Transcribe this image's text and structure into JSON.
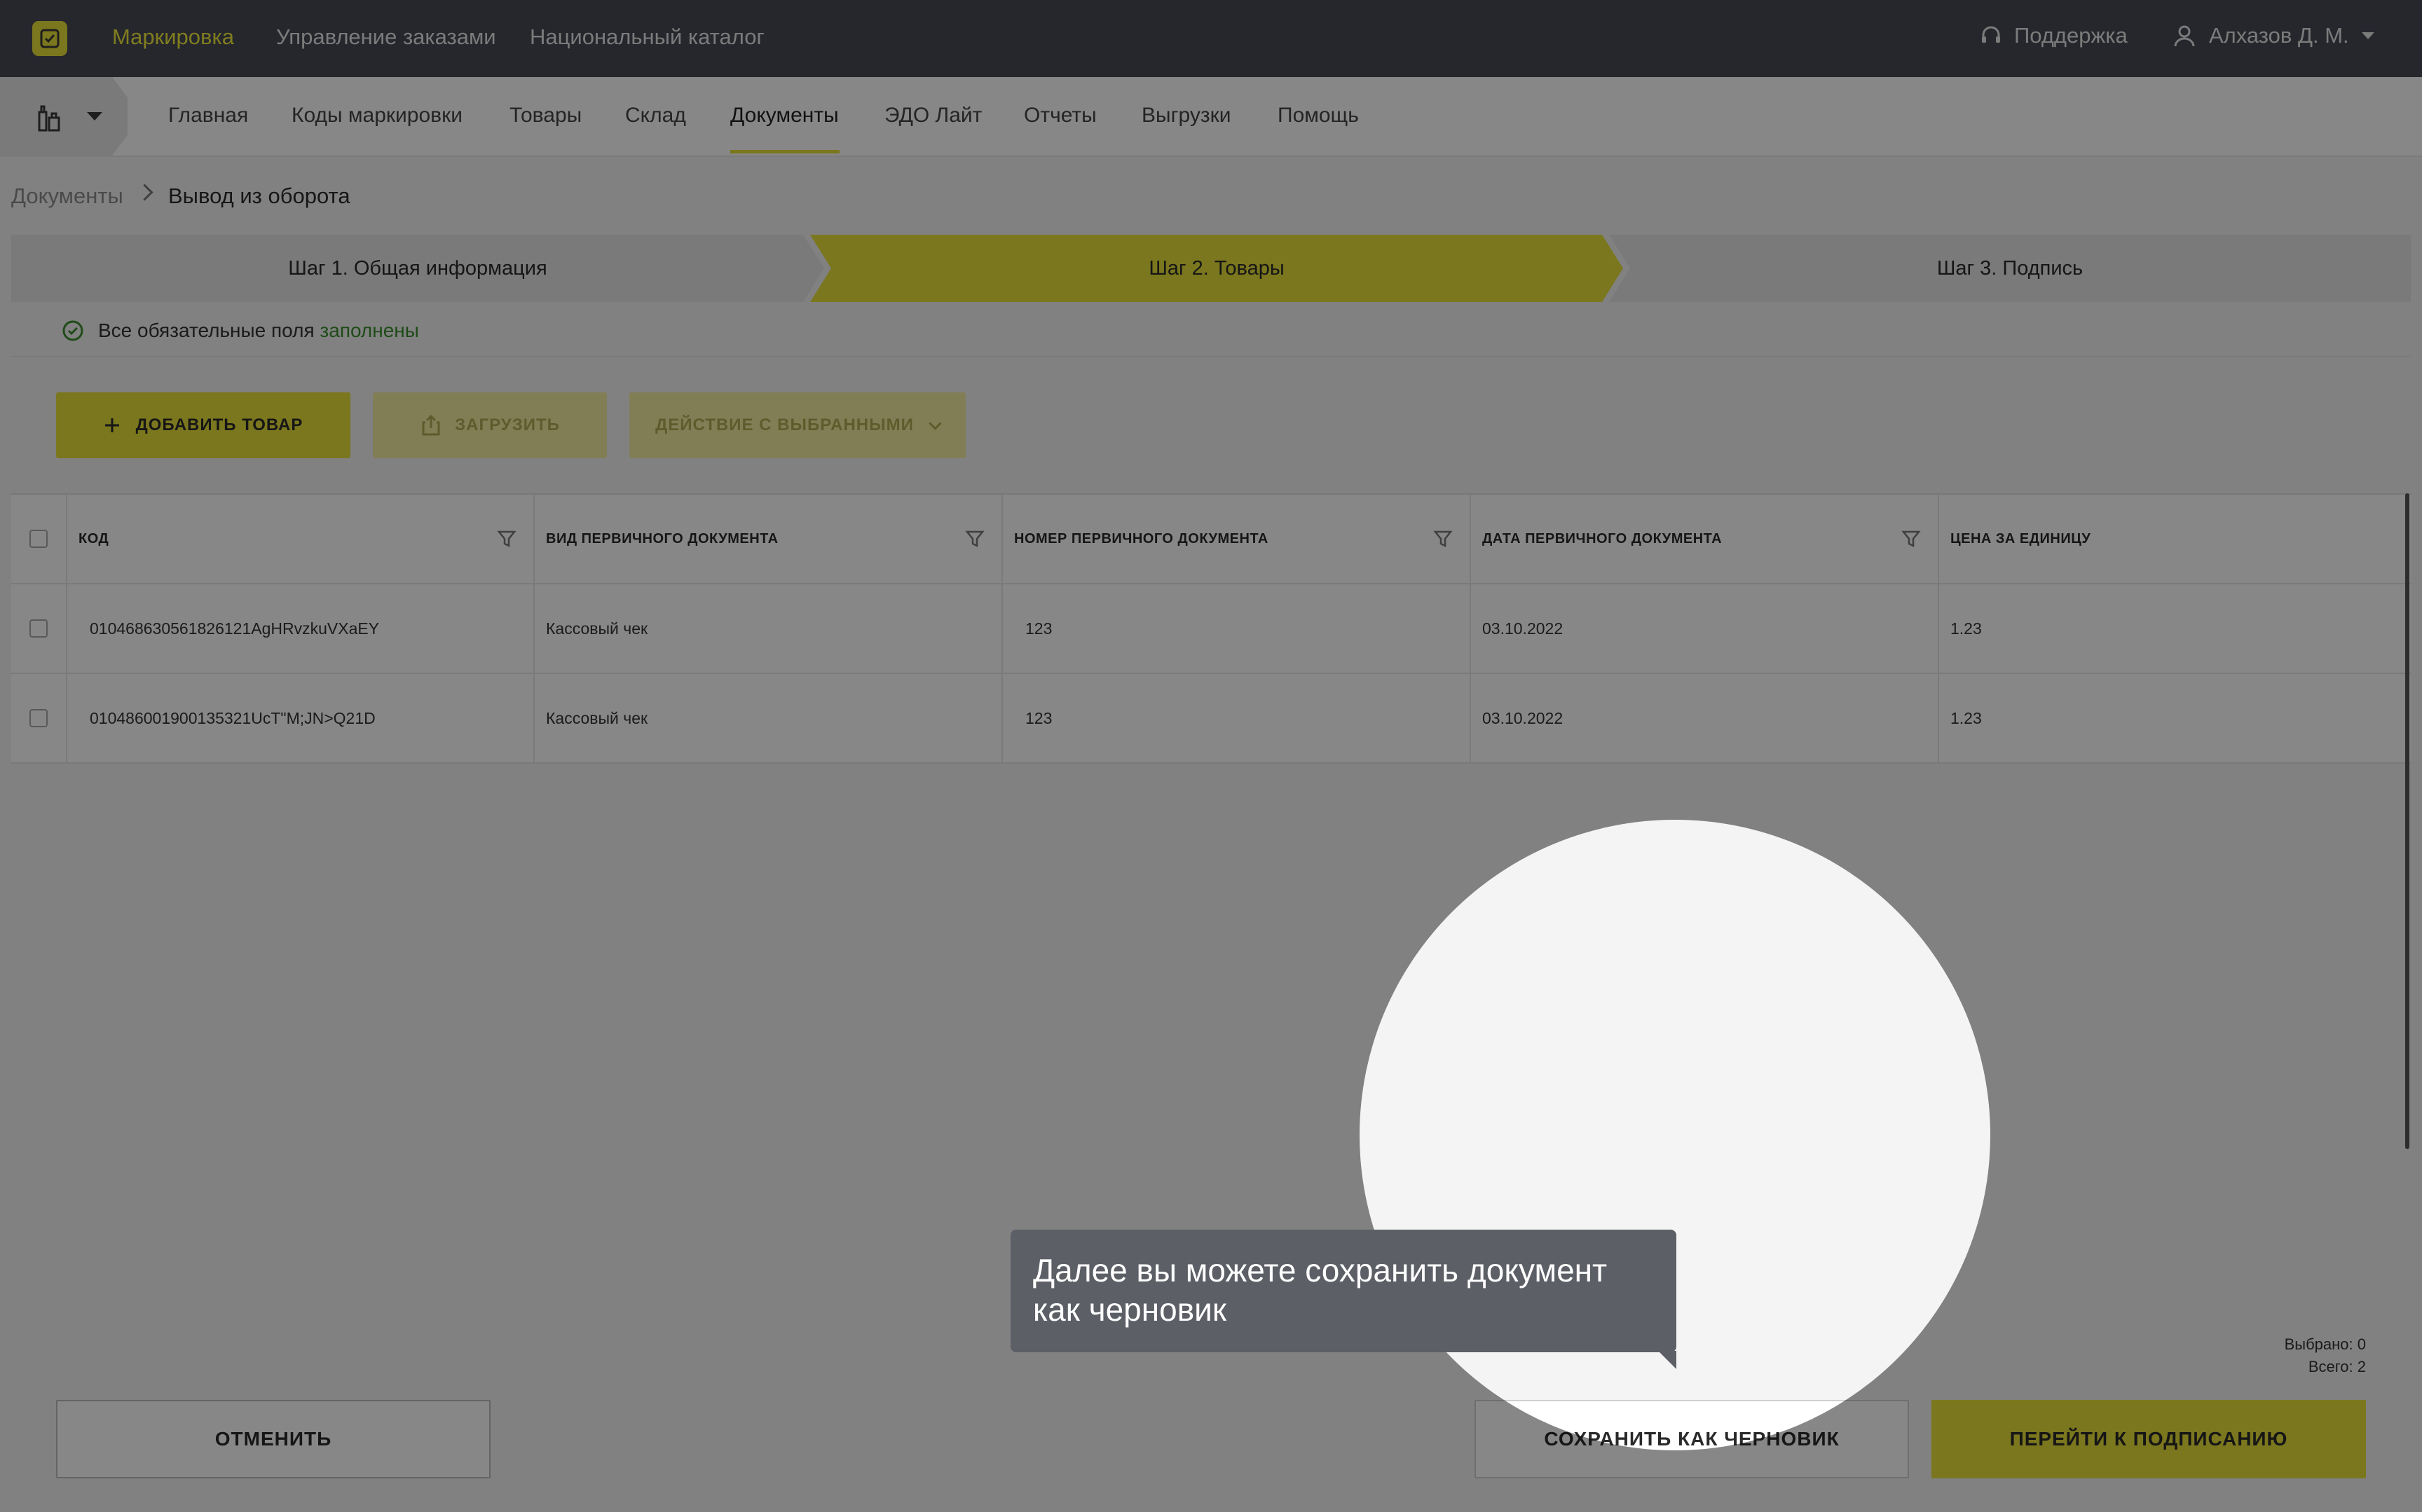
{
  "topnav": {
    "items": [
      "Маркировка",
      "Управление заказами",
      "Национальный каталог"
    ],
    "support": "Поддержка",
    "user": "Алхазов Д. М."
  },
  "subnav": {
    "items": [
      "Главная",
      "Коды маркировки",
      "Товары",
      "Склад",
      "Документы",
      "ЭДО Лайт",
      "Отчеты",
      "Выгрузки",
      "Помощь"
    ],
    "active": "Документы"
  },
  "breadcrumb": {
    "parent": "Документы",
    "current": "Вывод из оборота"
  },
  "steps": [
    "Шаг 1. Общая информация",
    "Шаг 2. Товары",
    "Шаг 3. Подпись"
  ],
  "active_step": 2,
  "status": {
    "text": "Все обязательные поля",
    "highlight": "заполнены"
  },
  "toolbar": {
    "add": "ДОБАВИТЬ ТОВАР",
    "upload": "ЗАГРУЗИТЬ",
    "action": "ДЕЙСТВИЕ С ВЫБРАННЫМИ"
  },
  "table": {
    "columns": [
      "КОД",
      "ВИД ПЕРВИЧНОГО ДОКУМЕНТА",
      "НОМЕР ПЕРВИЧНОГО ДОКУМЕНТА",
      "ДАТА ПЕРВИЧНОГО ДОКУМЕНТА",
      "ЦЕНА ЗА ЕДИНИЦУ"
    ],
    "rows": [
      [
        "010468630561826121AgHRvzkuVXaEY",
        "Кассовый чек",
        "123",
        "03.10.2022",
        "1.23"
      ],
      [
        "010486001900135321UcT\"M;JN>Q21D",
        "Кассовый чек",
        "123",
        "03.10.2022",
        "1.23"
      ]
    ]
  },
  "counts": {
    "selected": "Выбрано: 0",
    "total": "Всего: 2"
  },
  "footer": {
    "cancel": "ОТМЕНИТЬ",
    "draft": "СОХРАНИТЬ КАК ЧЕРНОВИК",
    "sign": "ПЕРЕЙТИ К ПОДПИСАНИЮ"
  },
  "tooltip": {
    "text": "Далее вы можете сохранить документ как черновик"
  },
  "colors": {
    "accent": "#e8e03a",
    "topbar": "#464b55",
    "ok": "#3c8f2f",
    "dim": "rgba(0,0,0,0.47)"
  }
}
